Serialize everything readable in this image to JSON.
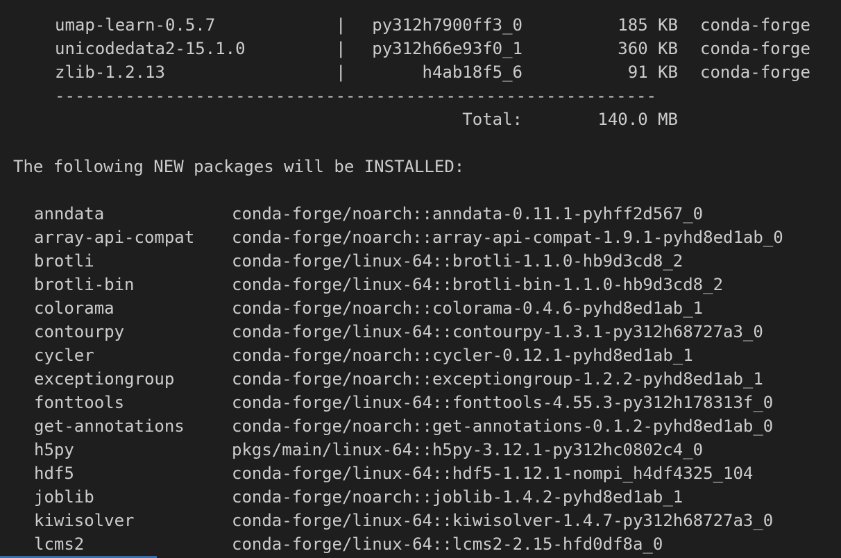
{
  "updated_packages": [
    {
      "name": "umap-learn-0.5.7",
      "sep": "|",
      "build": "py312h7900ff3_0",
      "size": "185 KB",
      "channel": "conda-forge"
    },
    {
      "name": "unicodedata2-15.1.0",
      "sep": "|",
      "build": "py312h66e93f0_1",
      "size": "360 KB",
      "channel": "conda-forge"
    },
    {
      "name": "zlib-1.2.13",
      "sep": "|",
      "build": "h4ab18f5_6",
      "size": "91 KB",
      "channel": "conda-forge"
    }
  ],
  "divider": "------------------------------------------------------------",
  "total_label": "Total:",
  "total_value": "140.0 MB",
  "install_header": "The following NEW packages will be INSTALLED:",
  "new_packages": [
    {
      "name": "anndata",
      "spec": "conda-forge/noarch::anndata-0.11.1-pyhff2d567_0"
    },
    {
      "name": "array-api-compat",
      "spec": "conda-forge/noarch::array-api-compat-1.9.1-pyhd8ed1ab_0"
    },
    {
      "name": "brotli",
      "spec": "conda-forge/linux-64::brotli-1.1.0-hb9d3cd8_2"
    },
    {
      "name": "brotli-bin",
      "spec": "conda-forge/linux-64::brotli-bin-1.1.0-hb9d3cd8_2"
    },
    {
      "name": "colorama",
      "spec": "conda-forge/noarch::colorama-0.4.6-pyhd8ed1ab_1"
    },
    {
      "name": "contourpy",
      "spec": "conda-forge/linux-64::contourpy-1.3.1-py312h68727a3_0"
    },
    {
      "name": "cycler",
      "spec": "conda-forge/noarch::cycler-0.12.1-pyhd8ed1ab_1"
    },
    {
      "name": "exceptiongroup",
      "spec": "conda-forge/noarch::exceptiongroup-1.2.2-pyhd8ed1ab_1"
    },
    {
      "name": "fonttools",
      "spec": "conda-forge/linux-64::fonttools-4.55.3-py312h178313f_0"
    },
    {
      "name": "get-annotations",
      "spec": "conda-forge/noarch::get-annotations-0.1.2-pyhd8ed1ab_0"
    },
    {
      "name": "h5py",
      "spec": "pkgs/main/linux-64::h5py-3.12.1-py312hc0802c4_0"
    },
    {
      "name": "hdf5",
      "spec": "conda-forge/linux-64::hdf5-1.12.1-nompi_h4df4325_104"
    },
    {
      "name": "joblib",
      "spec": "conda-forge/noarch::joblib-1.4.2-pyhd8ed1ab_1"
    },
    {
      "name": "kiwisolver",
      "spec": "conda-forge/linux-64::kiwisolver-1.4.7-py312h68727a3_0"
    },
    {
      "name": "lcms2",
      "spec": "conda-forge/linux-64::lcms2-2.15-hfd0df8a_0"
    }
  ]
}
